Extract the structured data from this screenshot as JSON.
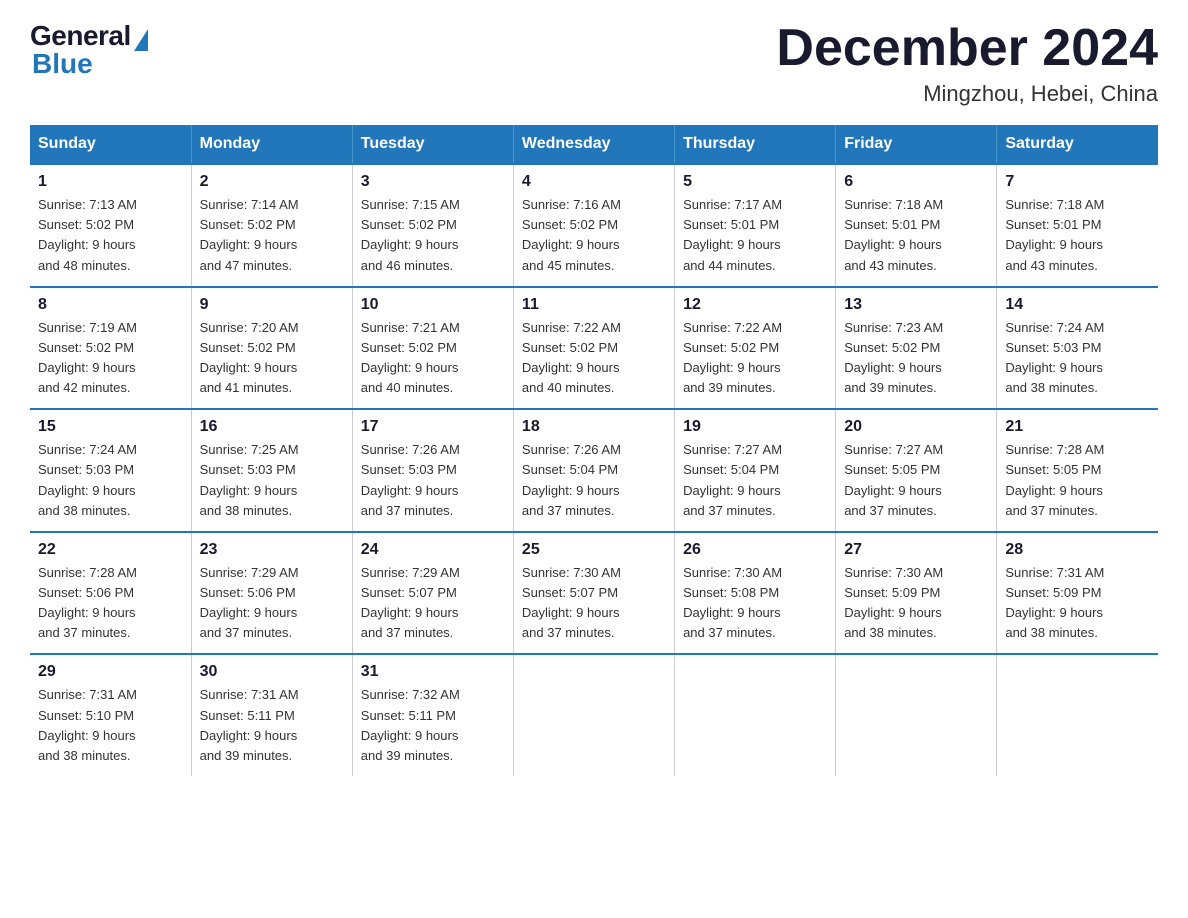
{
  "logo": {
    "general_text": "General",
    "blue_text": "Blue"
  },
  "header": {
    "month_year": "December 2024",
    "location": "Mingzhou, Hebei, China"
  },
  "days_of_week": [
    "Sunday",
    "Monday",
    "Tuesday",
    "Wednesday",
    "Thursday",
    "Friday",
    "Saturday"
  ],
  "weeks": [
    [
      {
        "day": "1",
        "sunrise": "7:13 AM",
        "sunset": "5:02 PM",
        "daylight": "9 hours and 48 minutes."
      },
      {
        "day": "2",
        "sunrise": "7:14 AM",
        "sunset": "5:02 PM",
        "daylight": "9 hours and 47 minutes."
      },
      {
        "day": "3",
        "sunrise": "7:15 AM",
        "sunset": "5:02 PM",
        "daylight": "9 hours and 46 minutes."
      },
      {
        "day": "4",
        "sunrise": "7:16 AM",
        "sunset": "5:02 PM",
        "daylight": "9 hours and 45 minutes."
      },
      {
        "day": "5",
        "sunrise": "7:17 AM",
        "sunset": "5:01 PM",
        "daylight": "9 hours and 44 minutes."
      },
      {
        "day": "6",
        "sunrise": "7:18 AM",
        "sunset": "5:01 PM",
        "daylight": "9 hours and 43 minutes."
      },
      {
        "day": "7",
        "sunrise": "7:18 AM",
        "sunset": "5:01 PM",
        "daylight": "9 hours and 43 minutes."
      }
    ],
    [
      {
        "day": "8",
        "sunrise": "7:19 AM",
        "sunset": "5:02 PM",
        "daylight": "9 hours and 42 minutes."
      },
      {
        "day": "9",
        "sunrise": "7:20 AM",
        "sunset": "5:02 PM",
        "daylight": "9 hours and 41 minutes."
      },
      {
        "day": "10",
        "sunrise": "7:21 AM",
        "sunset": "5:02 PM",
        "daylight": "9 hours and 40 minutes."
      },
      {
        "day": "11",
        "sunrise": "7:22 AM",
        "sunset": "5:02 PM",
        "daylight": "9 hours and 40 minutes."
      },
      {
        "day": "12",
        "sunrise": "7:22 AM",
        "sunset": "5:02 PM",
        "daylight": "9 hours and 39 minutes."
      },
      {
        "day": "13",
        "sunrise": "7:23 AM",
        "sunset": "5:02 PM",
        "daylight": "9 hours and 39 minutes."
      },
      {
        "day": "14",
        "sunrise": "7:24 AM",
        "sunset": "5:03 PM",
        "daylight": "9 hours and 38 minutes."
      }
    ],
    [
      {
        "day": "15",
        "sunrise": "7:24 AM",
        "sunset": "5:03 PM",
        "daylight": "9 hours and 38 minutes."
      },
      {
        "day": "16",
        "sunrise": "7:25 AM",
        "sunset": "5:03 PM",
        "daylight": "9 hours and 38 minutes."
      },
      {
        "day": "17",
        "sunrise": "7:26 AM",
        "sunset": "5:03 PM",
        "daylight": "9 hours and 37 minutes."
      },
      {
        "day": "18",
        "sunrise": "7:26 AM",
        "sunset": "5:04 PM",
        "daylight": "9 hours and 37 minutes."
      },
      {
        "day": "19",
        "sunrise": "7:27 AM",
        "sunset": "5:04 PM",
        "daylight": "9 hours and 37 minutes."
      },
      {
        "day": "20",
        "sunrise": "7:27 AM",
        "sunset": "5:05 PM",
        "daylight": "9 hours and 37 minutes."
      },
      {
        "day": "21",
        "sunrise": "7:28 AM",
        "sunset": "5:05 PM",
        "daylight": "9 hours and 37 minutes."
      }
    ],
    [
      {
        "day": "22",
        "sunrise": "7:28 AM",
        "sunset": "5:06 PM",
        "daylight": "9 hours and 37 minutes."
      },
      {
        "day": "23",
        "sunrise": "7:29 AM",
        "sunset": "5:06 PM",
        "daylight": "9 hours and 37 minutes."
      },
      {
        "day": "24",
        "sunrise": "7:29 AM",
        "sunset": "5:07 PM",
        "daylight": "9 hours and 37 minutes."
      },
      {
        "day": "25",
        "sunrise": "7:30 AM",
        "sunset": "5:07 PM",
        "daylight": "9 hours and 37 minutes."
      },
      {
        "day": "26",
        "sunrise": "7:30 AM",
        "sunset": "5:08 PM",
        "daylight": "9 hours and 37 minutes."
      },
      {
        "day": "27",
        "sunrise": "7:30 AM",
        "sunset": "5:09 PM",
        "daylight": "9 hours and 38 minutes."
      },
      {
        "day": "28",
        "sunrise": "7:31 AM",
        "sunset": "5:09 PM",
        "daylight": "9 hours and 38 minutes."
      }
    ],
    [
      {
        "day": "29",
        "sunrise": "7:31 AM",
        "sunset": "5:10 PM",
        "daylight": "9 hours and 38 minutes."
      },
      {
        "day": "30",
        "sunrise": "7:31 AM",
        "sunset": "5:11 PM",
        "daylight": "9 hours and 39 minutes."
      },
      {
        "day": "31",
        "sunrise": "7:32 AM",
        "sunset": "5:11 PM",
        "daylight": "9 hours and 39 minutes."
      },
      null,
      null,
      null,
      null
    ]
  ],
  "labels": {
    "sunrise": "Sunrise:",
    "sunset": "Sunset:",
    "daylight": "Daylight:"
  }
}
